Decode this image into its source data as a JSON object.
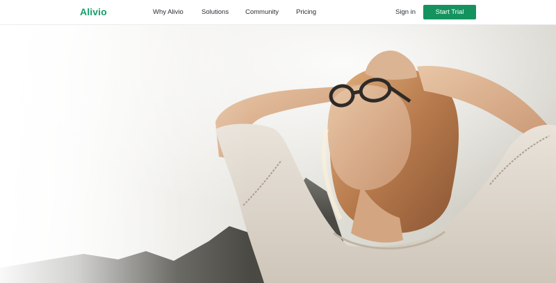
{
  "brand": {
    "name": "Alivio",
    "color": "#13a06b"
  },
  "nav": {
    "links": [
      {
        "label": "Why Alivio"
      },
      {
        "label": "Solutions"
      },
      {
        "label": "Community"
      },
      {
        "label": "Pricing"
      }
    ],
    "sign_in": "Sign in",
    "cta": {
      "label": "Start Trial",
      "color": "#14935f"
    }
  },
  "hero": {
    "image": "hero-photo-woman-relaxing-in-sunlight"
  }
}
